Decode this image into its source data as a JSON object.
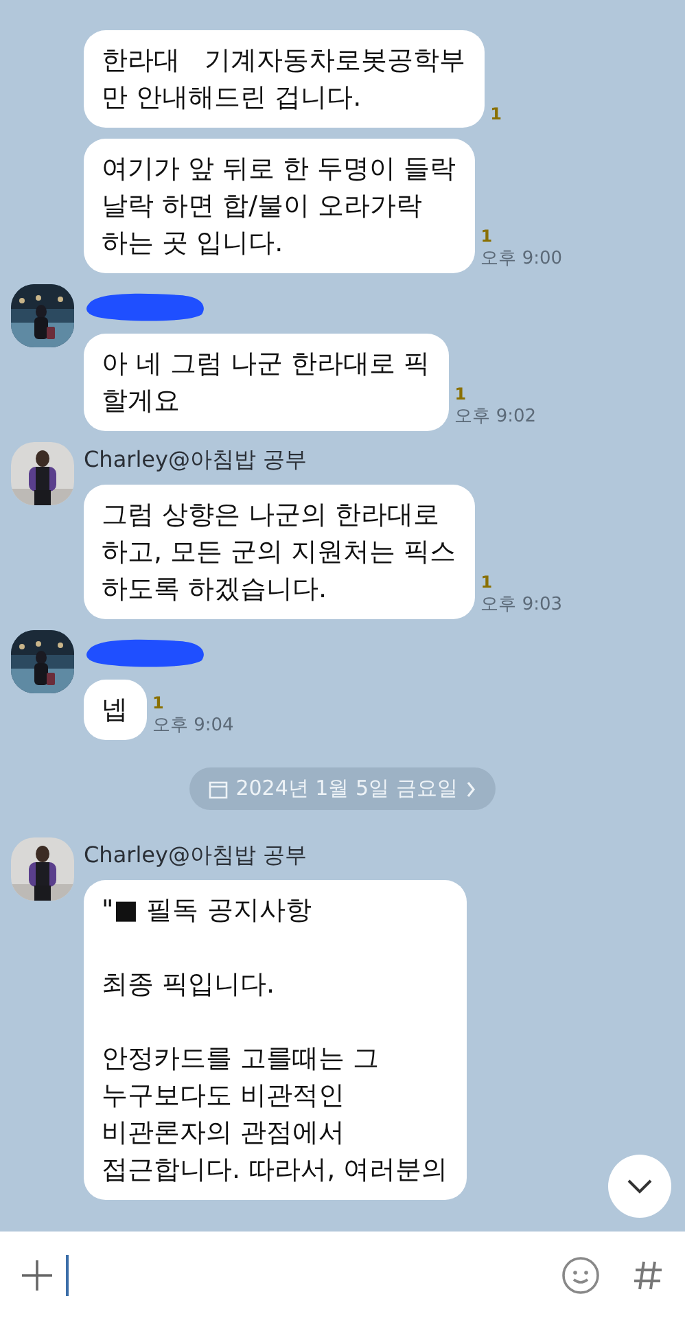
{
  "chat": [
    {
      "kind": "messages",
      "messages": [
        {
          "text": "한라대   기계자동차로봇공학부\n만 안내해드린 겁니다.",
          "unread": "1"
        },
        {
          "text": "여기가 앞 뒤로 한 두명이 들락\n날락 하면 합/불이 오라가락\n하는 곳 입니다.",
          "unread": "1",
          "time": "오후 9:00"
        }
      ]
    },
    {
      "kind": "messages",
      "sender": {
        "kind": "hidden"
      },
      "messages": [
        {
          "text": "아 네 그럼 나군 한라대로 픽\n할게요",
          "unread": "1",
          "time": "오후 9:02"
        }
      ]
    },
    {
      "kind": "messages",
      "sender": {
        "kind": "named",
        "name": "Charley@아침밥 공부"
      },
      "messages": [
        {
          "text": "그럼 상향은 나군의 한라대로\n하고, 모든 군의 지원처는 픽스\n하도록 하겠습니다.",
          "unread": "1",
          "time": "오후 9:03"
        }
      ]
    },
    {
      "kind": "messages",
      "sender": {
        "kind": "hidden"
      },
      "messages": [
        {
          "text": "넵",
          "unread": "1",
          "time": "오후 9:04"
        }
      ]
    },
    {
      "kind": "date",
      "label": "2024년 1월 5일 금요일"
    },
    {
      "kind": "messages",
      "sender": {
        "kind": "named",
        "name": "Charley@아침밥 공부"
      },
      "messages": [
        {
          "text": "\"■ 필독 공지사항\n\n최종 픽입니다.\n\n안정카드를 고를때는 그\n누구보다도 비관적인\n비관론자의 관점에서\n접근합니다. 따라서, 여러분의"
        }
      ]
    }
  ]
}
